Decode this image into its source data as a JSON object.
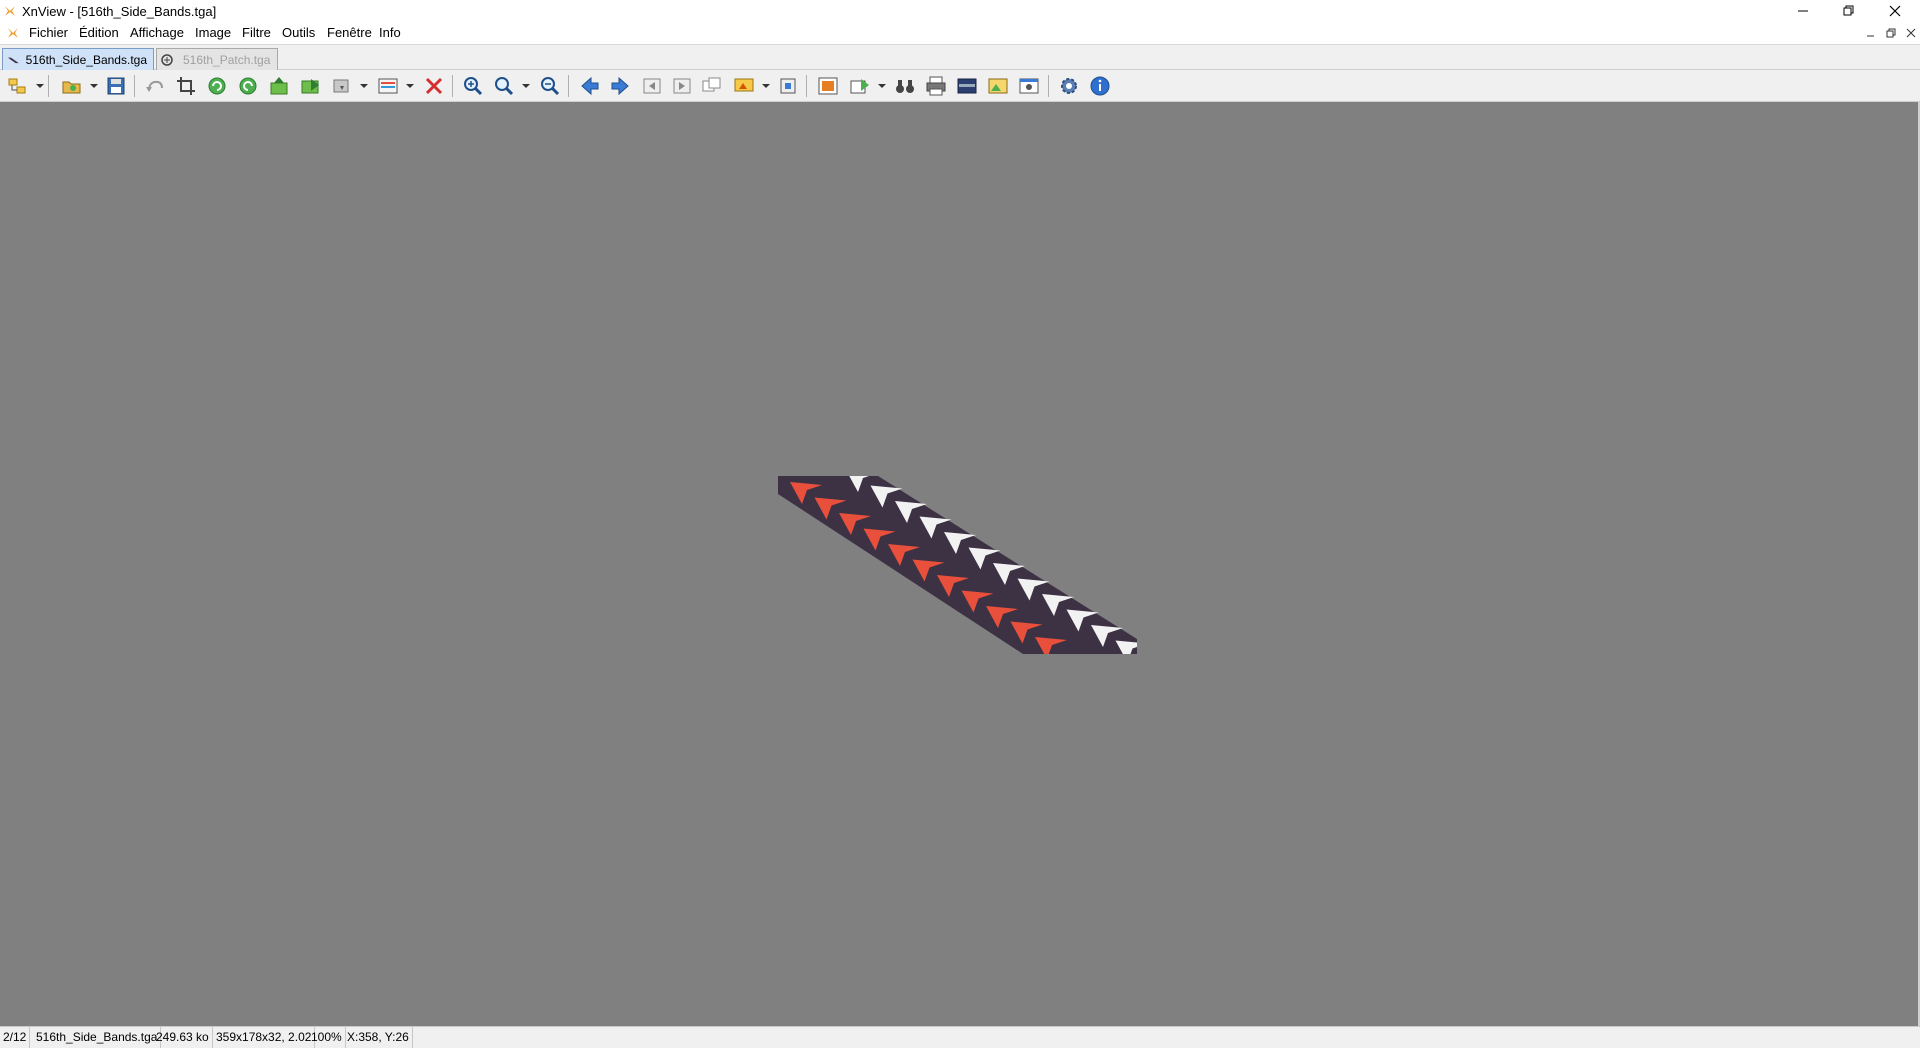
{
  "window": {
    "title": "XnView - [516th_Side_Bands.tga]",
    "controls": [
      "minimize",
      "restore",
      "close"
    ]
  },
  "menu": {
    "items": [
      "Fichier",
      "Édition",
      "Affichage",
      "Image",
      "Filtre",
      "Outils",
      "Fenêtre",
      "Info"
    ]
  },
  "tabs": [
    {
      "label": "516th_Side_Bands.tga",
      "active": true
    },
    {
      "label": "516th_Patch.tga",
      "active": false
    }
  ],
  "toolbar": {
    "icons": [
      "browser-icon",
      "open-icon",
      "save-icon",
      "undo-icon",
      "crop-icon",
      "rotate-left-icon",
      "rotate-right-icon",
      "flip-vertical-icon",
      "flip-horizontal-icon",
      "convert-icon",
      "adjust-icon",
      "delete-icon",
      "zoom-in-icon",
      "zoom-options-icon",
      "zoom-out-icon",
      "previous-icon",
      "next-icon",
      "first-icon",
      "last-icon",
      "windows-icon",
      "slideshow-icon",
      "resize-icon",
      "fullscreen-icon",
      "export-icon",
      "search-icon",
      "print-icon",
      "scanner-icon",
      "wallpaper-icon",
      "capture-icon",
      "settings-icon",
      "info-icon"
    ]
  },
  "image": {
    "colors": {
      "band": "#3d3144",
      "red": "#e8503c",
      "white": "#f2f2f2"
    }
  },
  "statusbar": {
    "position": "2/12",
    "filename": "516th_Side_Bands.tga",
    "filesize": "249.63 ko",
    "dimensions": "359x178x32, 2.02",
    "zoom": "100%",
    "cursor": "X:358, Y:26"
  },
  "colors": {
    "canvas": "#808080",
    "chrome": "#f0f0f0",
    "active_tab": "#cfe2f7"
  }
}
